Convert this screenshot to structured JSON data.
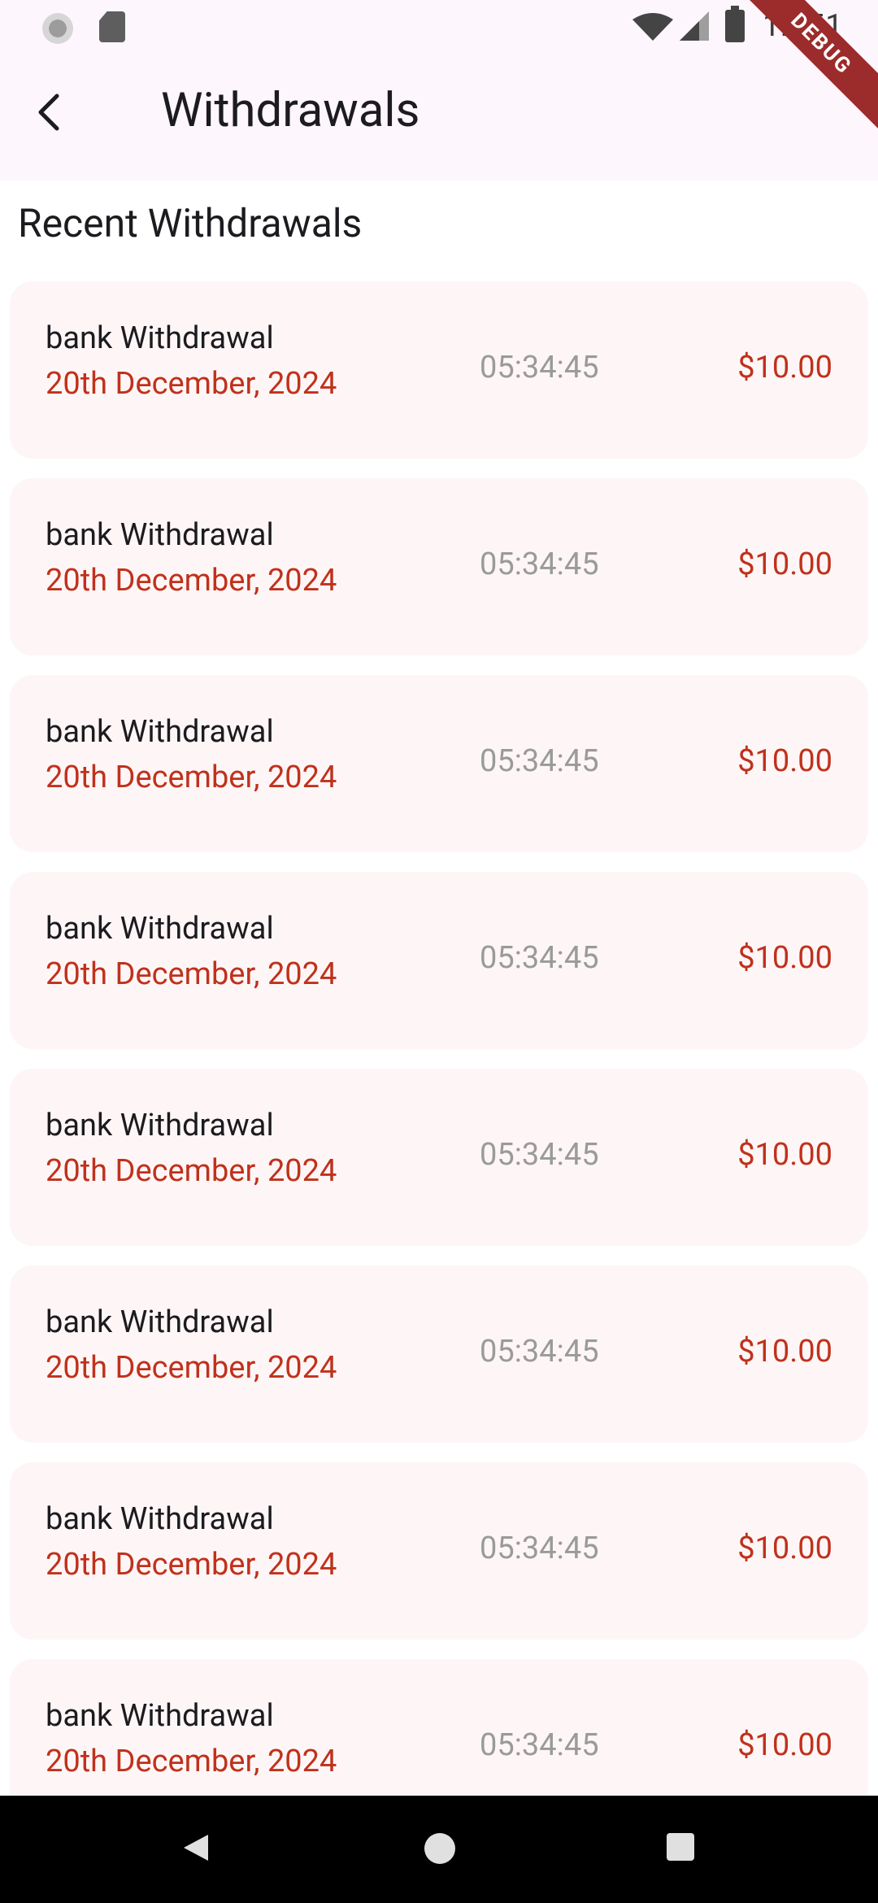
{
  "status_bar": {
    "time": "12:51",
    "icons": [
      "circle-icon",
      "sd-card-icon",
      "wifi-icon",
      "signal-icon",
      "battery-icon"
    ]
  },
  "debug_banner": "DEBUG",
  "app_bar": {
    "title": "Withdrawals",
    "back_icon": "chevron-left-icon"
  },
  "section_title": "Recent Withdrawals",
  "withdrawals": [
    {
      "type": "bank Withdrawal",
      "date": "20th December, 2024",
      "time": "05:34:45",
      "amount": "$10.00"
    },
    {
      "type": "bank Withdrawal",
      "date": "20th December, 2024",
      "time": "05:34:45",
      "amount": "$10.00"
    },
    {
      "type": "bank Withdrawal",
      "date": "20th December, 2024",
      "time": "05:34:45",
      "amount": "$10.00"
    },
    {
      "type": "bank Withdrawal",
      "date": "20th December, 2024",
      "time": "05:34:45",
      "amount": "$10.00"
    },
    {
      "type": "bank Withdrawal",
      "date": "20th December, 2024",
      "time": "05:34:45",
      "amount": "$10.00"
    },
    {
      "type": "bank Withdrawal",
      "date": "20th December, 2024",
      "time": "05:34:45",
      "amount": "$10.00"
    },
    {
      "type": "bank Withdrawal",
      "date": "20th December, 2024",
      "time": "05:34:45",
      "amount": "$10.00"
    },
    {
      "type": "bank Withdrawal",
      "date": "20th December, 2024",
      "time": "05:34:45",
      "amount": "$10.00"
    }
  ],
  "colors": {
    "accent_red": "#c0311c",
    "card_bg": "#fef6f6",
    "app_bar_bg": "#fdf6fc",
    "time_gray": "#9a9a9a"
  },
  "nav_bar": {
    "icons": [
      "nav-back-icon",
      "nav-home-icon",
      "nav-recents-icon"
    ]
  }
}
